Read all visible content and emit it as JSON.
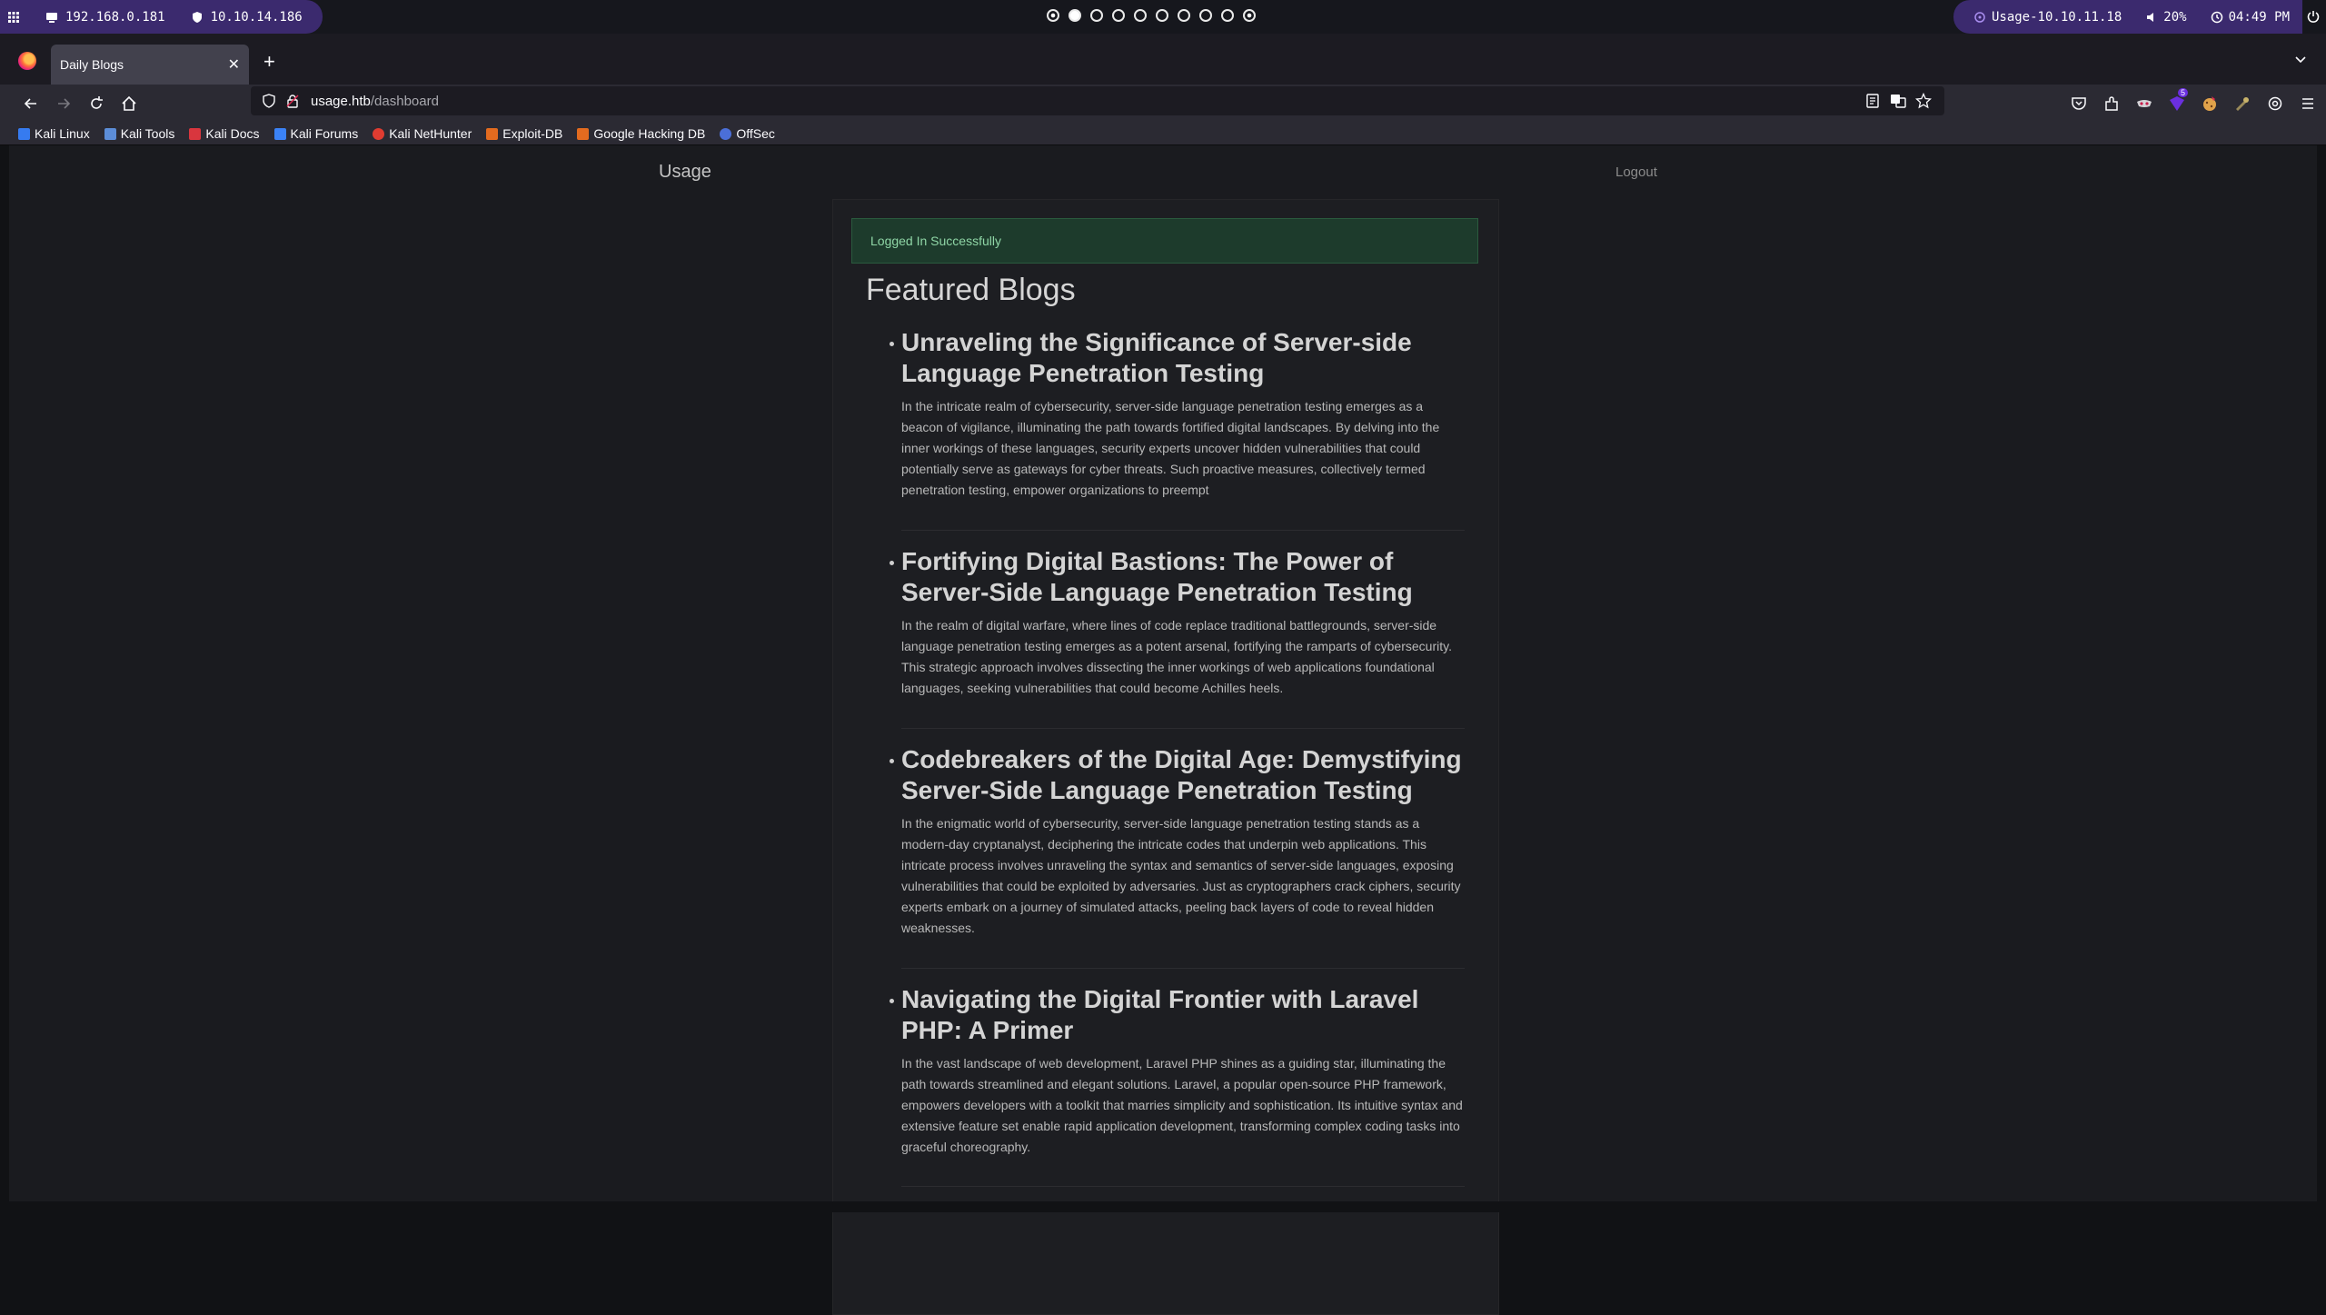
{
  "system_bar": {
    "ip_local": "192.168.0.181",
    "ip_vpn": "10.10.14.186",
    "target": "Usage-10.10.11.18",
    "volume": "20%",
    "clock": "04:49 PM",
    "workspaces": 10,
    "active_workspace": 2
  },
  "browser": {
    "tab_title": "Daily Blogs",
    "url_host": "usage.htb",
    "url_path": "/dashboard",
    "extension_badge": "5",
    "bookmarks": [
      {
        "label": "Kali Linux",
        "icon": "kali-icon",
        "color": "#367bf0"
      },
      {
        "label": "Kali Tools",
        "icon": "kali-tools-icon",
        "color": "#5c8dd8"
      },
      {
        "label": "Kali Docs",
        "icon": "kali-docs-icon",
        "color": "#d9363e"
      },
      {
        "label": "Kali Forums",
        "icon": "kali-forums-icon",
        "color": "#3b82f6"
      },
      {
        "label": "Kali NetHunter",
        "icon": "nethunter-icon",
        "color": "#e03c31"
      },
      {
        "label": "Exploit-DB",
        "icon": "exploit-db-icon",
        "color": "#e36b1f"
      },
      {
        "label": "Google Hacking DB",
        "icon": "ghdb-icon",
        "color": "#e36b1f"
      },
      {
        "label": "OffSec",
        "icon": "offsec-icon",
        "color": "#4b6fd8"
      }
    ]
  },
  "site": {
    "brand": "Usage",
    "logout": "Logout",
    "alert": "Logged In Successfully",
    "heading": "Featured Blogs",
    "posts": [
      {
        "title": "Unraveling the Significance of Server-side Language Penetration Testing",
        "body": "In the intricate realm of cybersecurity, server-side language penetration testing emerges as a beacon of vigilance, illuminating the path towards fortified digital landscapes. By delving into the inner workings of these languages, security experts uncover hidden vulnerabilities that could potentially serve as gateways for cyber threats. Such proactive measures, collectively termed penetration testing, empower organizations to preempt"
      },
      {
        "title": "Fortifying Digital Bastions: The Power of Server-Side Language Penetration Testing",
        "body": "In the realm of digital warfare, where lines of code replace traditional battlegrounds, server-side language penetration testing emerges as a potent arsenal, fortifying the ramparts of cybersecurity. This strategic approach involves dissecting the inner workings of web applications foundational languages, seeking vulnerabilities that could become Achilles heels."
      },
      {
        "title": "Codebreakers of the Digital Age: Demystifying Server-Side Language Penetration Testing",
        "body": "In the enigmatic world of cybersecurity, server-side language penetration testing stands as a modern-day cryptanalyst, deciphering the intricate codes that underpin web applications. This intricate process involves unraveling the syntax and semantics of server-side languages, exposing vulnerabilities that could be exploited by adversaries. Just as cryptographers crack ciphers, security experts embark on a journey of simulated attacks, peeling back layers of code to reveal hidden weaknesses."
      },
      {
        "title": "Navigating the Digital Frontier with Laravel PHP: A Primer",
        "body": "In the vast landscape of web development, Laravel PHP shines as a guiding star, illuminating the path towards streamlined and elegant solutions. Laravel, a popular open-source PHP framework, empowers developers with a toolkit that marries simplicity and sophistication. Its intuitive syntax and extensive feature set enable rapid application development, transforming complex coding tasks into graceful choreography."
      }
    ]
  }
}
